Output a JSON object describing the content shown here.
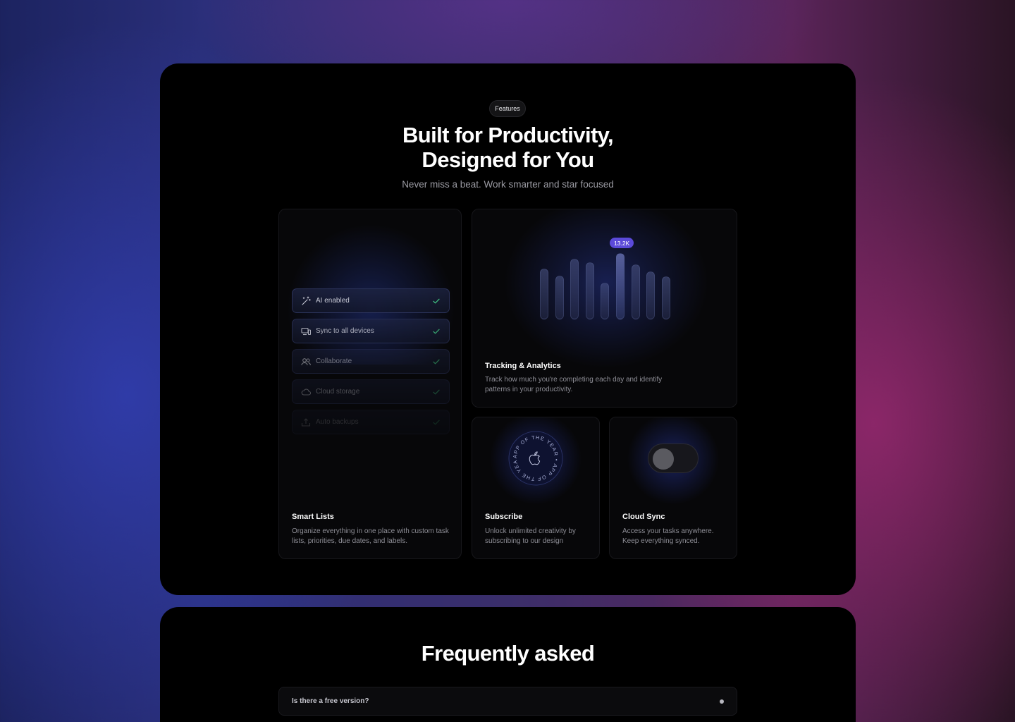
{
  "features_section": {
    "pill_label": "Features",
    "title_line1": "Built for Productivity,",
    "title_line2": "Designed for You",
    "subtitle": "Never miss a beat. Work smarter and star focused"
  },
  "smart_lists": {
    "title": "Smart Lists",
    "description": "Organize everything in one place with custom task lists, priorities, due dates, and labels.",
    "items": [
      {
        "label": "AI enabled",
        "icon": "magic-wand-icon",
        "opacity": 1.0
      },
      {
        "label": "Sync to all devices",
        "icon": "devices-icon",
        "opacity": 0.85
      },
      {
        "label": "Collaborate",
        "icon": "users-icon",
        "opacity": 0.55
      },
      {
        "label": "Cloud storage",
        "icon": "cloud-icon",
        "opacity": 0.35
      },
      {
        "label": "Auto backups",
        "icon": "upload-tray-icon",
        "opacity": 0.18
      }
    ],
    "check_color": "#3fbf7f"
  },
  "tracking": {
    "title": "Tracking & Analytics",
    "description": "Track how much you're completing each day and identify patterns in your productivity.",
    "badge": "13.2K",
    "bar_levels": [
      0.55,
      0.48,
      0.66,
      0.62,
      0.4,
      0.72,
      0.6,
      0.52,
      0.47
    ],
    "highlight_index": 5
  },
  "subscribe": {
    "title": "Subscribe",
    "description": "Unlock unlimited creativity by subscribing to our design",
    "seal_text": "APP OF THE YEAR • APP OF THE YEAR • "
  },
  "cloud_sync": {
    "title": "Cloud Sync",
    "description": "Access your tasks anywhere. Keep everything synced.",
    "toggle_state": "off"
  },
  "faq": {
    "title": "Frequently asked",
    "items": [
      {
        "question": "Is there a free version?"
      }
    ]
  },
  "colors": {
    "accent": "#5b4ad9",
    "check": "#3fbf7f"
  }
}
